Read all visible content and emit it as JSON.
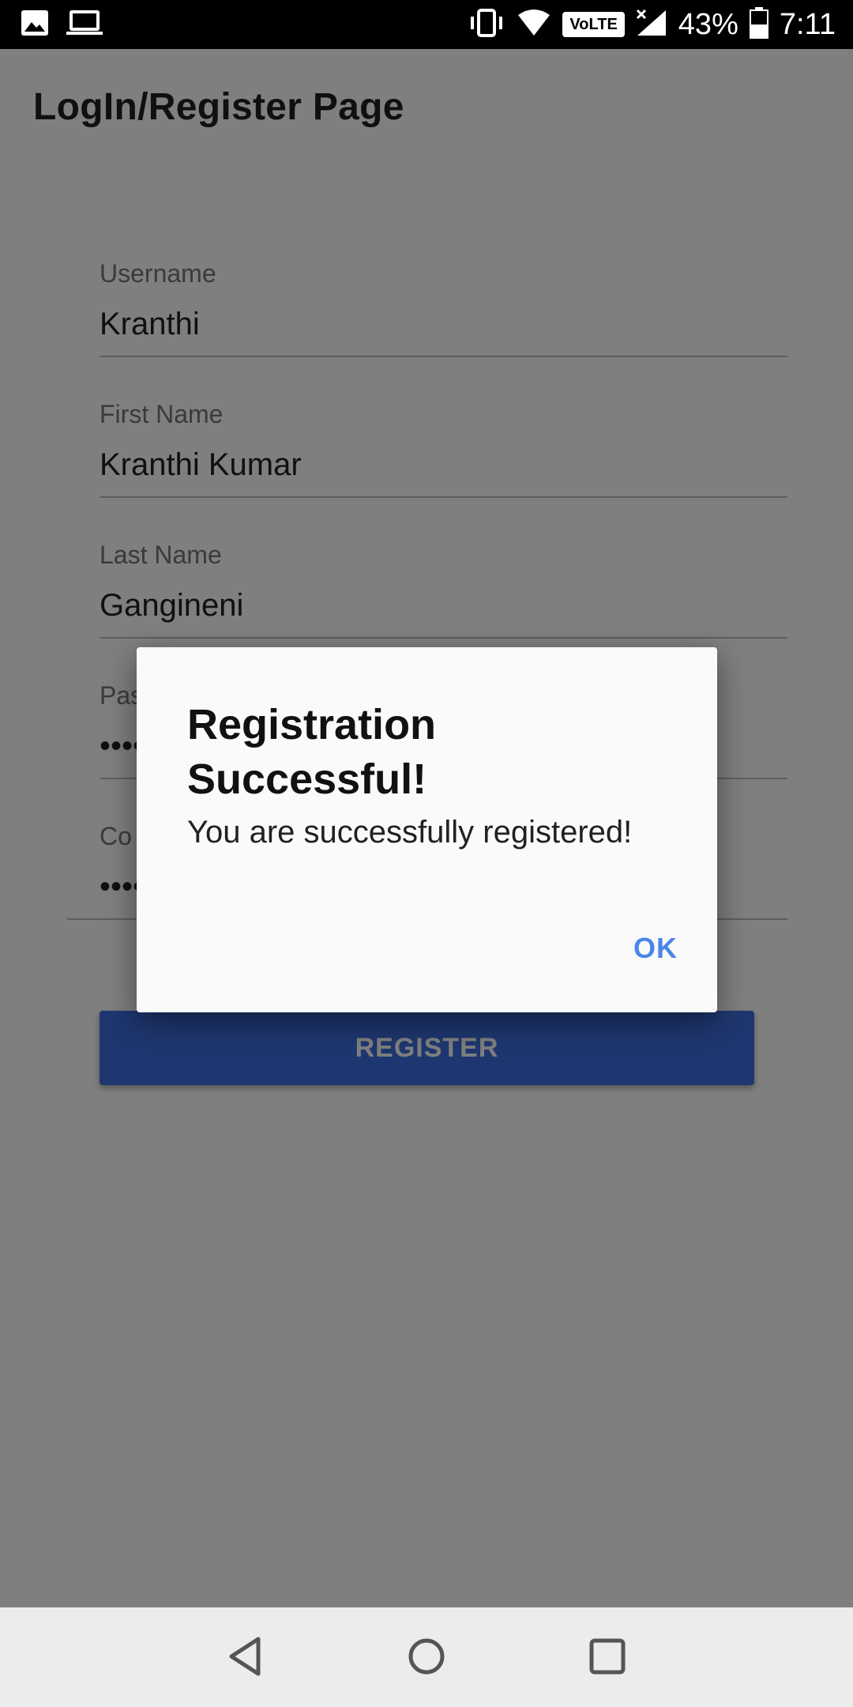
{
  "status_bar": {
    "battery": "43%",
    "time": "7:11",
    "network_badge": "VoLTE",
    "icons": [
      "gallery-icon",
      "laptop-icon",
      "vibrate-icon",
      "wifi-icon",
      "volte-icon",
      "signal-icon",
      "battery-icon"
    ]
  },
  "app_bar": {
    "title": "LogIn/Register Page"
  },
  "form": {
    "username": {
      "label": "Username",
      "value": "Kranthi"
    },
    "first_name": {
      "label": "First Name",
      "value": "Kranthi Kumar"
    },
    "last_name": {
      "label": "Last Name",
      "value": "Gangineni"
    },
    "password": {
      "label": "Pas",
      "value": "••••"
    },
    "confirm_password": {
      "label": "Co",
      "value": "••••"
    },
    "register_label": "REGISTER"
  },
  "dialog": {
    "title": "Registration Successful!",
    "message": "You are successfully registered!",
    "ok_label": "OK"
  },
  "colors": {
    "accent": "#4a86e8",
    "button": "#3f6fe0"
  },
  "nav_bar": {
    "icons": [
      "back-icon",
      "home-icon",
      "recents-icon"
    ]
  }
}
